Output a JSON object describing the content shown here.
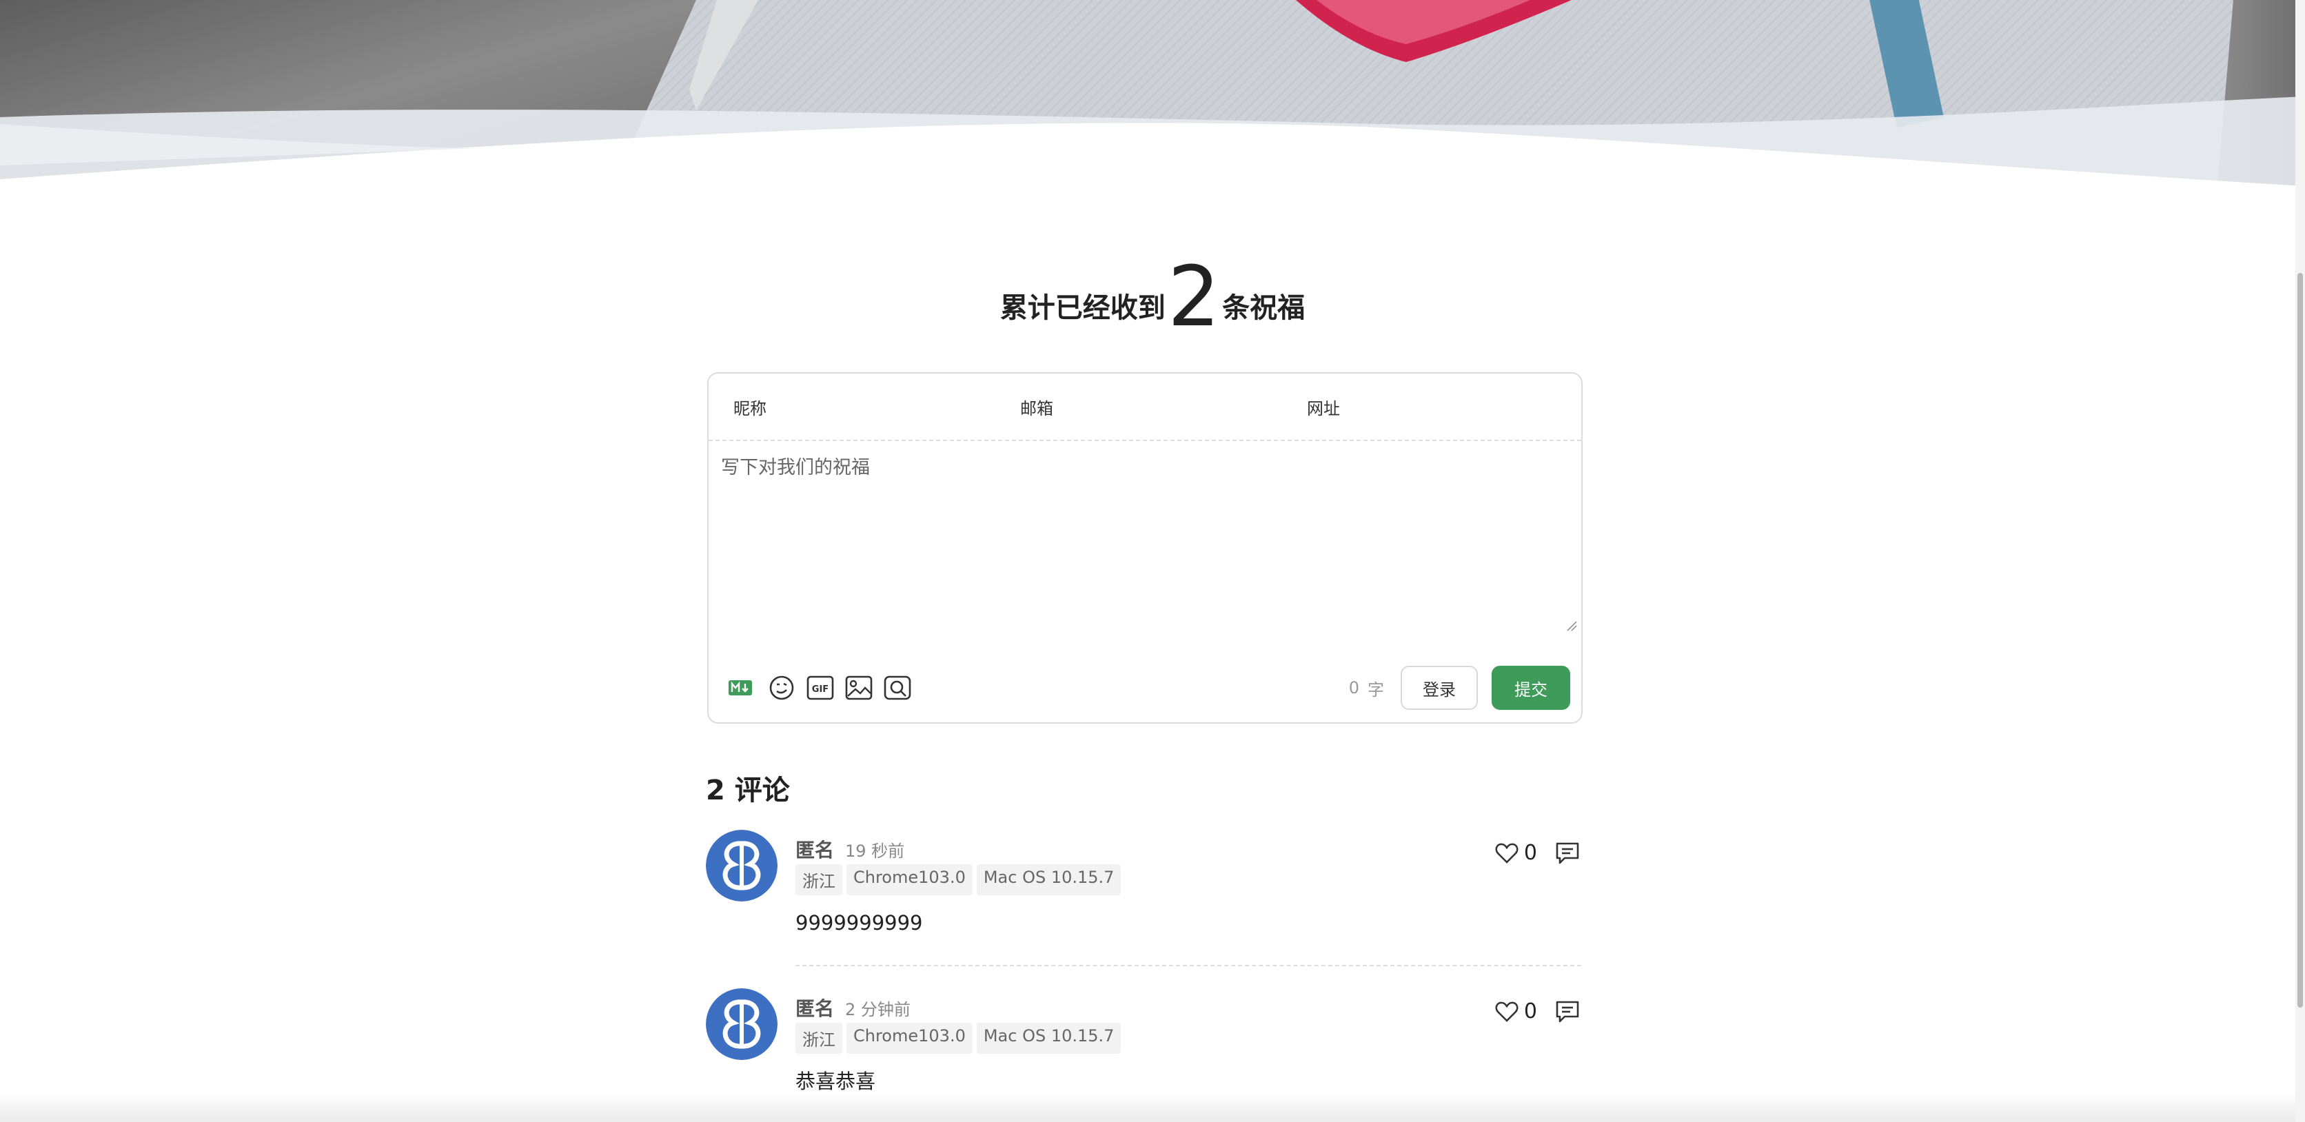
{
  "colors": {
    "accent": "#3f9b59",
    "avatar_bg": "#3d6fc3",
    "heart_pink": "#e0245e"
  },
  "hero": {
    "image": "paper-heart-photo"
  },
  "header": {
    "prefix": "累计已经收到",
    "count": "2",
    "suffix": "条祝福"
  },
  "form": {
    "nick_label": "昵称",
    "mail_label": "邮箱",
    "link_label": "网址",
    "placeholder": "写下对我们的祝福",
    "word_count": "0",
    "word_unit": "字",
    "login_label": "登录",
    "submit_label": "提交",
    "tools": [
      "markdown-icon",
      "emoji-icon",
      "gif-icon",
      "image-icon",
      "preview-icon"
    ]
  },
  "comments": {
    "count_label": "2 评论",
    "items": [
      {
        "nick": "匿名",
        "time": "19 秒前",
        "tags": [
          "浙江",
          "Chrome103.0",
          "Mac OS 10.15.7"
        ],
        "content": "9999999999",
        "likes": "0"
      },
      {
        "nick": "匿名",
        "time": "2 分钟前",
        "tags": [
          "浙江",
          "Chrome103.0",
          "Mac OS 10.15.7"
        ],
        "content": "恭喜恭喜",
        "likes": "0"
      }
    ]
  }
}
